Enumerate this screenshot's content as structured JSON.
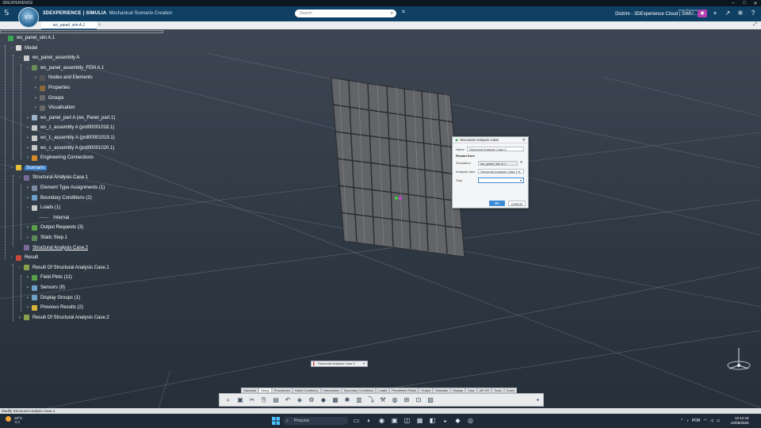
{
  "window": {
    "title": "3DEXPERIENCE",
    "controls": [
      "–",
      "□",
      "✕"
    ]
  },
  "appbar": {
    "brand": "3DEXPERIENCE | SIMULIA",
    "app_name": "Mechanical Scenario Creation",
    "compass_label": "V.R",
    "search_placeholder": "Search",
    "role": "Jean Rouleau",
    "tenant": "Distrim - 3DExperience Cloud | SIMU...",
    "icons": [
      "tag-icon",
      "avatar",
      "plus-icon",
      "share-icon",
      "tools-icon",
      "help-icon"
    ]
  },
  "tabs": {
    "active": "ws_panel_sim A.1",
    "plus": "+"
  },
  "tree": {
    "nodes": [
      {
        "label": "ws_panel_sim A.1",
        "level": 0,
        "toggle": "",
        "icon_color": "#3aa655"
      },
      {
        "label": "Model",
        "level": 1,
        "toggle": "−",
        "icon_color": "#d9d9d9"
      },
      {
        "label": "ws_panel_assembly A",
        "level": 2,
        "toggle": "−",
        "icon_color": "#c9c9c9"
      },
      {
        "label": "ws_panel_assembly_FEM A.1",
        "level": 3,
        "toggle": "−",
        "icon_color": "#6c8a5a"
      },
      {
        "label": "Nodes and Elements",
        "level": 4,
        "toggle": "+",
        "icon_color": "#555555"
      },
      {
        "label": "Properties",
        "level": 4,
        "toggle": "+",
        "icon_color": "#8a6a3a"
      },
      {
        "label": "Groups",
        "level": 4,
        "toggle": "+",
        "icon_color": "#6a6a6a"
      },
      {
        "label": "Visualisation",
        "level": 4,
        "toggle": "+",
        "icon_color": "#6a6a6a"
      },
      {
        "label": "ws_panel_part A (ws_Panel_part.1)",
        "level": 3,
        "toggle": "+",
        "icon_color": "#9bb6cc"
      },
      {
        "label": "ws_z_assembly A (prd00001018.1)",
        "level": 3,
        "toggle": "+",
        "icon_color": "#c9c9c9"
      },
      {
        "label": "ws_L_assembly A (prd00001019.1)",
        "level": 3,
        "toggle": "+",
        "icon_color": "#c9c9c9"
      },
      {
        "label": "ws_c_assembly A (prd00001020.1)",
        "level": 3,
        "toggle": "+",
        "icon_color": "#c9c9c9"
      },
      {
        "label": "Engineering Connections",
        "level": 3,
        "toggle": "+",
        "icon_color": "#d88a2a"
      },
      {
        "label": "Scenario",
        "level": 1,
        "toggle": "−",
        "icon_color": "#e5c03a",
        "selected": true
      },
      {
        "label": "Structural Analysis Case.1",
        "level": 2,
        "toggle": "−",
        "icon_color": "#7a6a9a"
      },
      {
        "label": "Element Type Assignments (1)",
        "level": 3,
        "toggle": "+",
        "icon_color": "#7a8aa0"
      },
      {
        "label": "Boundary Conditions (2)",
        "level": 3,
        "toggle": "+",
        "icon_color": "#6fa0c8"
      },
      {
        "label": "Loads (1)",
        "level": 3,
        "toggle": "−",
        "icon_color": "#c8c8c8"
      },
      {
        "label": "Internal",
        "level": 4,
        "toggle": "",
        "icon_color": ""
      },
      {
        "label": "Output Requests (3)",
        "level": 3,
        "toggle": "+",
        "icon_color": "#5aa04a"
      },
      {
        "label": "Static Step.1",
        "level": 3,
        "toggle": "+",
        "icon_color": "#5a8a5a"
      },
      {
        "label": "Structural Analysis Case.2",
        "level": 2,
        "toggle": "",
        "icon_color": "#7a6a9a",
        "underline": true
      },
      {
        "label": "Result",
        "level": 1,
        "toggle": "−",
        "icon_color": "#c8463a"
      },
      {
        "label": "Result Of Structural Analysis Case.1",
        "level": 2,
        "toggle": "−",
        "icon_color": "#8aa04a"
      },
      {
        "label": "Field Plots (11)",
        "level": 3,
        "toggle": "+",
        "icon_color": "#5aa04a"
      },
      {
        "label": "Sensors (9)",
        "level": 3,
        "toggle": "+",
        "icon_color": "#6fa0c8"
      },
      {
        "label": "Display Groups (1)",
        "level": 3,
        "toggle": "+",
        "icon_color": "#6fa0c8"
      },
      {
        "label": "Previous Results (2)",
        "level": 3,
        "toggle": "+",
        "icon_color": "#d8b43a"
      },
      {
        "label": "Result Of Structural Analysis Case.2",
        "level": 2,
        "toggle": "+",
        "icon_color": "#8aa04a"
      }
    ]
  },
  "dialog": {
    "title": "Structural Analysis Case",
    "name_label": "Name",
    "name_value": "Structural Analysis Case.2",
    "section": "Restart from",
    "simulation_label": "Simulation",
    "simulation_value": "ws_panel_sim A.1",
    "analysis_case_label": "Analysis case",
    "analysis_case_value": "Structural Analysis Case.1",
    "step_label": "Step",
    "step_value": "",
    "ok": "OK",
    "cancel": "Cancel"
  },
  "float_tab": {
    "label": "Structural Analysis Case.2"
  },
  "palette": {
    "tabs": [
      "Standard",
      "Setup",
      "Procedures",
      "Initial Conditions",
      "Interactions",
      "Boundary Conditions",
      "Loads",
      "Predefined Fields",
      "Output",
      "Simulate",
      "Display",
      "View",
      "AR-VR",
      "Tools",
      "Touch"
    ],
    "active_tab": "Setup",
    "icons": [
      "⌕",
      "▣",
      "✂",
      "⎘",
      "▤",
      "↶",
      "◈",
      "⚙",
      "◆",
      "▦",
      "✱",
      "▥",
      "⤵",
      "⚒",
      "◍",
      "⊞",
      "⊡",
      "▧"
    ]
  },
  "status": "Modify Structural Analysis Case.4",
  "taskbar": {
    "weather_temp": "24°C",
    "weather_desc": "Sol",
    "search": "Procurar",
    "apps": [
      "▭",
      "◐",
      "◉",
      "▣",
      "◫",
      "▦",
      "◧",
      "◒",
      "◆",
      "◎"
    ],
    "lang": "POR",
    "time": "12:12:18",
    "date": "22/08/2025"
  }
}
